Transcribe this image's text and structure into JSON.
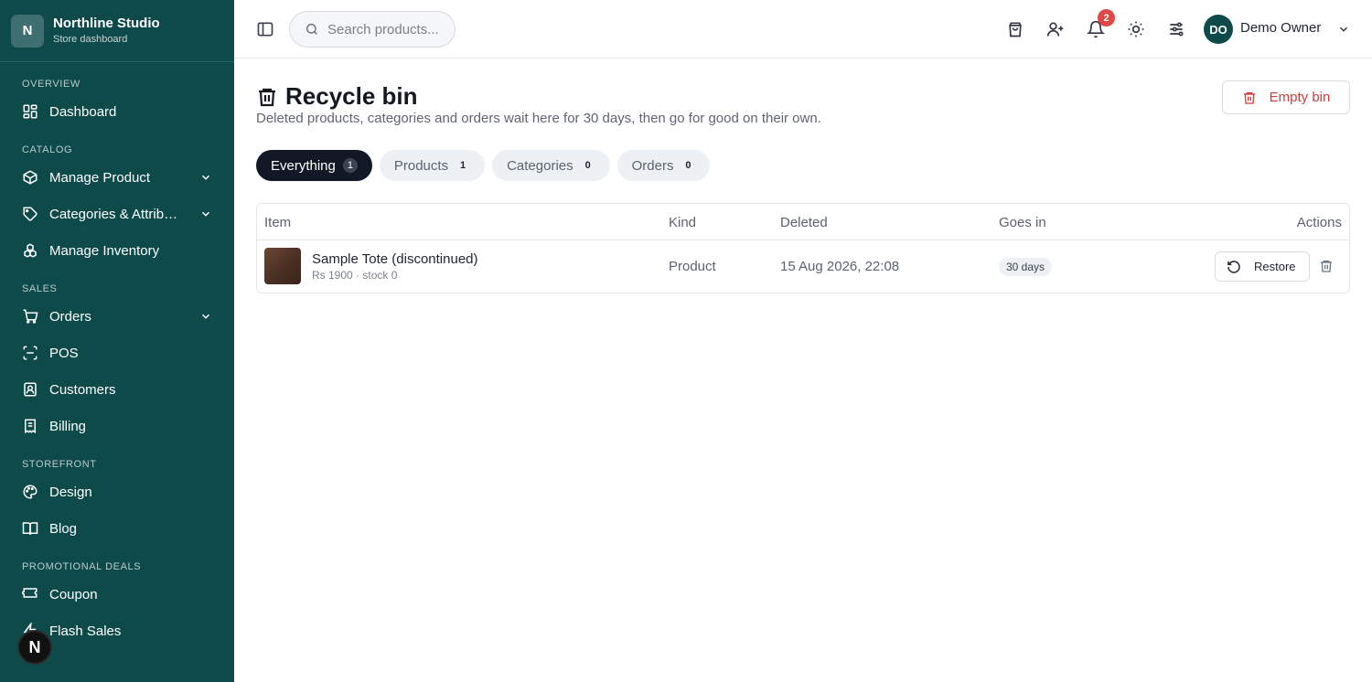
{
  "brand": {
    "initial": "N",
    "name": "Northline Studio",
    "subtitle": "Store dashboard"
  },
  "sidebar": {
    "sections": [
      {
        "title": "OVERVIEW",
        "items": [
          {
            "label": "Dashboard",
            "icon": "grid-icon"
          }
        ]
      },
      {
        "title": "CATALOG",
        "items": [
          {
            "label": "Manage Product",
            "icon": "box-icon",
            "expandable": true
          },
          {
            "label": "Categories & Attributes",
            "icon": "tag-icon",
            "expandable": true
          },
          {
            "label": "Manage Inventory",
            "icon": "boxes-icon"
          }
        ]
      },
      {
        "title": "SALES",
        "items": [
          {
            "label": "Orders",
            "icon": "cart-icon",
            "expandable": true
          },
          {
            "label": "POS",
            "icon": "scan-icon"
          },
          {
            "label": "Customers",
            "icon": "contact-icon"
          },
          {
            "label": "Billing",
            "icon": "receipt-icon"
          }
        ]
      },
      {
        "title": "STOREFRONT",
        "items": [
          {
            "label": "Design",
            "icon": "palette-icon"
          },
          {
            "label": "Blog",
            "icon": "book-icon"
          }
        ]
      },
      {
        "title": "PROMOTIONAL DEALS",
        "items": [
          {
            "label": "Coupon",
            "icon": "ticket-icon"
          },
          {
            "label": "Flash Sales",
            "icon": "zap-icon"
          }
        ]
      }
    ],
    "floating_badge": "N"
  },
  "topbar": {
    "search_placeholder": "Search products...",
    "notification_count": "2",
    "user_initials": "DO",
    "user_name": "Demo Owner"
  },
  "page": {
    "title": "Recycle bin",
    "description": "Deleted products, categories and orders wait here for 30 days, then go for good on their own.",
    "empty_button": "Empty bin",
    "tabs": [
      {
        "label": "Everything",
        "count": "1",
        "active": true
      },
      {
        "label": "Products",
        "count": "1"
      },
      {
        "label": "Categories",
        "count": "0"
      },
      {
        "label": "Orders",
        "count": "0"
      }
    ],
    "table": {
      "headers": {
        "item": "Item",
        "kind": "Kind",
        "deleted": "Deleted",
        "goes_in": "Goes in",
        "actions": "Actions"
      },
      "rows": [
        {
          "name": "Sample Tote (discontinued)",
          "meta": "Rs 1900 · stock 0",
          "kind": "Product",
          "deleted": "15 Aug 2026, 22:08",
          "goes_in": "30 days",
          "restore_label": "Restore"
        }
      ]
    }
  },
  "colors": {
    "sidebar": "#0f4a4a",
    "danger": "#d23a3a",
    "active_tab": "#121826",
    "badge": "#e04848"
  }
}
